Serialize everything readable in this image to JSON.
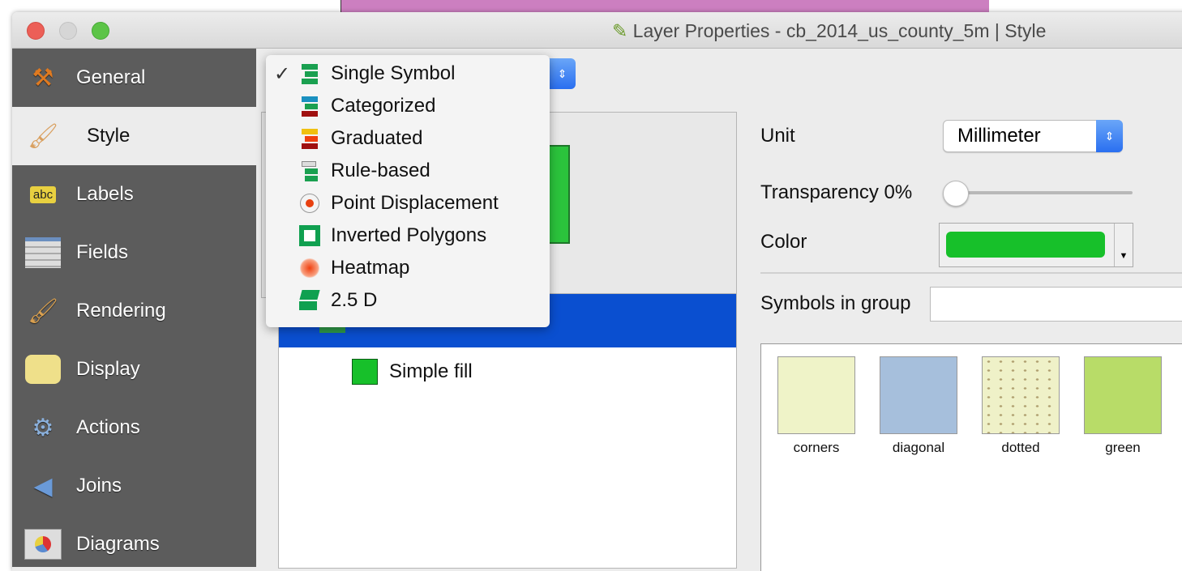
{
  "window": {
    "title": "Layer Properties - cb_2014_us_county_5m | Style"
  },
  "sidebar": {
    "items": [
      {
        "label": "General",
        "icon": "tools-icon"
      },
      {
        "label": "Style",
        "icon": "paintbrush-icon",
        "selected": true
      },
      {
        "label": "Labels",
        "icon": "labels-abc-icon"
      },
      {
        "label": "Fields",
        "icon": "table-icon"
      },
      {
        "label": "Rendering",
        "icon": "brush-icon"
      },
      {
        "label": "Display",
        "icon": "speech-bubble-icon"
      },
      {
        "label": "Actions",
        "icon": "gear-play-icon"
      },
      {
        "label": "Joins",
        "icon": "join-arrow-icon"
      },
      {
        "label": "Diagrams",
        "icon": "pie-chart-icon"
      }
    ]
  },
  "renderer_menu": {
    "items": [
      {
        "label": "Single Symbol",
        "checked": true
      },
      {
        "label": "Categorized"
      },
      {
        "label": "Graduated"
      },
      {
        "label": "Rule-based"
      },
      {
        "label": "Point Displacement"
      },
      {
        "label": "Inverted Polygons"
      },
      {
        "label": "Heatmap"
      },
      {
        "label": "2.5 D"
      }
    ]
  },
  "symbol_tree": {
    "child": "Simple fill"
  },
  "properties": {
    "unit_label": "Unit",
    "unit_value": "Millimeter",
    "transparency_label": "Transparency 0%",
    "transparency_value": 0,
    "color_label": "Color",
    "color": "#17c02a",
    "symbols_in_group_label": "Symbols in group",
    "symbols_in_group_value": ""
  },
  "symbols": [
    {
      "name": "corners",
      "color": "#eff3c8"
    },
    {
      "name": "diagonal",
      "color": "#a6bfdc"
    },
    {
      "name": "dotted",
      "color": "#eff1c8"
    },
    {
      "name": "green",
      "color": "#b8dc68"
    }
  ]
}
